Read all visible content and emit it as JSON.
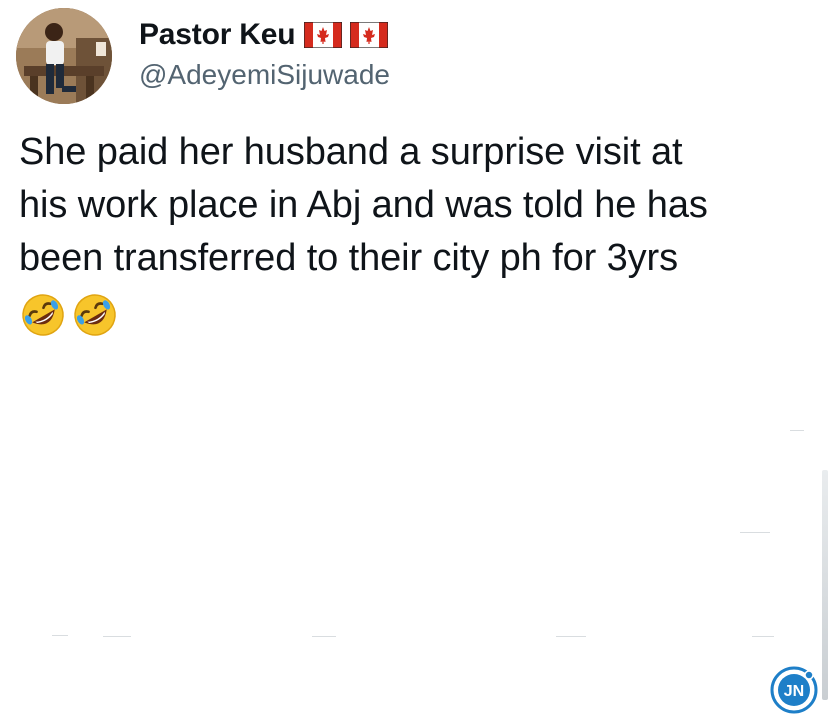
{
  "author": {
    "display_name": "Pastor Keu",
    "handle": "@AdeyemiSijuwade",
    "flags": [
      "canada-flag",
      "canada-flag"
    ]
  },
  "tweet": {
    "text": "She paid her husband a surprise visit at\nhis work place in Abj and was told he has\nbeen transferred to their city ph for 3yrs",
    "emojis": [
      "rolling-on-floor-laughing",
      "rolling-on-floor-laughing"
    ]
  },
  "watermark": {
    "text": "JN"
  },
  "colors": {
    "text": "#0f1419",
    "handle": "#536471",
    "flag_red": "#d52b1e",
    "watermark_blue": "#1e7fc8"
  }
}
